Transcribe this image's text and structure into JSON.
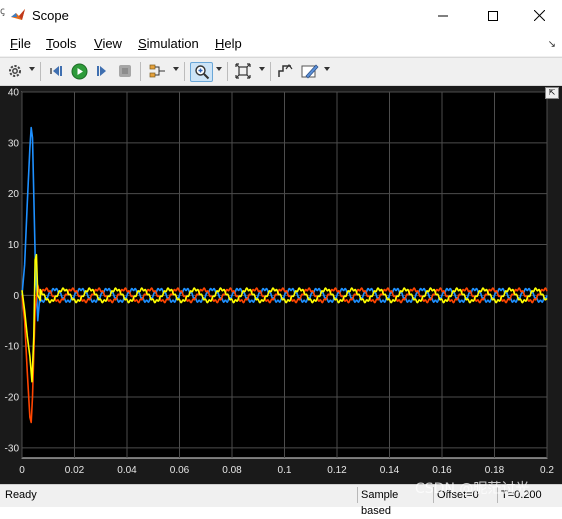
{
  "window": {
    "title": "Scope"
  },
  "menu": [
    "File",
    "Tools",
    "View",
    "Simulation",
    "Help"
  ],
  "toolbar": {
    "icons": [
      "settings-icon",
      "step-back-icon",
      "run-icon",
      "step-forward-icon",
      "stop-icon",
      "signal-select-icon",
      "zoom-icon",
      "autoscale-icon",
      "triggers-icon",
      "style-icon"
    ]
  },
  "status": {
    "left": "Ready",
    "sample_based": "Sample based",
    "offset": "Offset=0",
    "time": "T=0.200"
  },
  "watermark": "CSDN @昵茫讨光",
  "colors": {
    "background": "#000000",
    "grid": "#4d4d4d",
    "axis_text": "#e6e6e6",
    "series_blue": "#0072BD",
    "series_orange": "#D95319",
    "series_yellow": "#EDB120",
    "accent_blue": "#1e90ff"
  },
  "chart_data": {
    "type": "line",
    "title": "",
    "xlabel": "",
    "ylabel": "",
    "xlim": [
      0,
      0.2
    ],
    "ylim": [
      -32,
      40
    ],
    "x_ticks": [
      0,
      0.02,
      0.04,
      0.06,
      0.08,
      0.1,
      0.12,
      0.14,
      0.16,
      0.18,
      0.2
    ],
    "x_tick_labels": [
      "0",
      "0.02",
      "0.04",
      "0.06",
      "0.08",
      "0.1",
      "0.12",
      "0.14",
      "0.16",
      "0.18",
      "0.2"
    ],
    "y_ticks": [
      -30,
      -20,
      -10,
      0,
      10,
      20,
      30,
      40
    ],
    "y_tick_labels": [
      "-30",
      "-20",
      "-10",
      "0",
      "10",
      "20",
      "30",
      "40"
    ],
    "grid": true,
    "series": [
      {
        "color": "#1E90FF",
        "transient": [
          [
            0,
            0
          ],
          [
            0.001,
            6
          ],
          [
            0.002,
            18
          ],
          [
            0.003,
            29
          ],
          [
            0.0035,
            33
          ],
          [
            0.004,
            31
          ],
          [
            0.005,
            8
          ],
          [
            0.006,
            -5
          ],
          [
            0.0065,
            -2
          ],
          [
            0.007,
            1
          ]
        ],
        "steady_amplitude": 1.2,
        "frequency_hz": 100,
        "phase_deg": 0
      },
      {
        "color": "#FF4500",
        "transient": [
          [
            0,
            0
          ],
          [
            0.001,
            -5
          ],
          [
            0.002,
            -15
          ],
          [
            0.003,
            -24
          ],
          [
            0.0035,
            -25
          ],
          [
            0.004,
            -20
          ],
          [
            0.005,
            -3
          ],
          [
            0.006,
            2
          ],
          [
            0.007,
            0
          ]
        ],
        "steady_amplitude": 1.2,
        "frequency_hz": 100,
        "phase_deg": 120
      },
      {
        "color": "#FFFF00",
        "transient": [
          [
            0,
            1
          ],
          [
            0.001,
            -3
          ],
          [
            0.002,
            -8
          ],
          [
            0.003,
            -12
          ],
          [
            0.0038,
            -17
          ],
          [
            0.0045,
            -8
          ],
          [
            0.005,
            7
          ],
          [
            0.0055,
            8
          ],
          [
            0.006,
            0
          ],
          [
            0.007,
            -1
          ]
        ],
        "steady_amplitude": 1.2,
        "frequency_hz": 100,
        "phase_deg": 240
      }
    ]
  }
}
